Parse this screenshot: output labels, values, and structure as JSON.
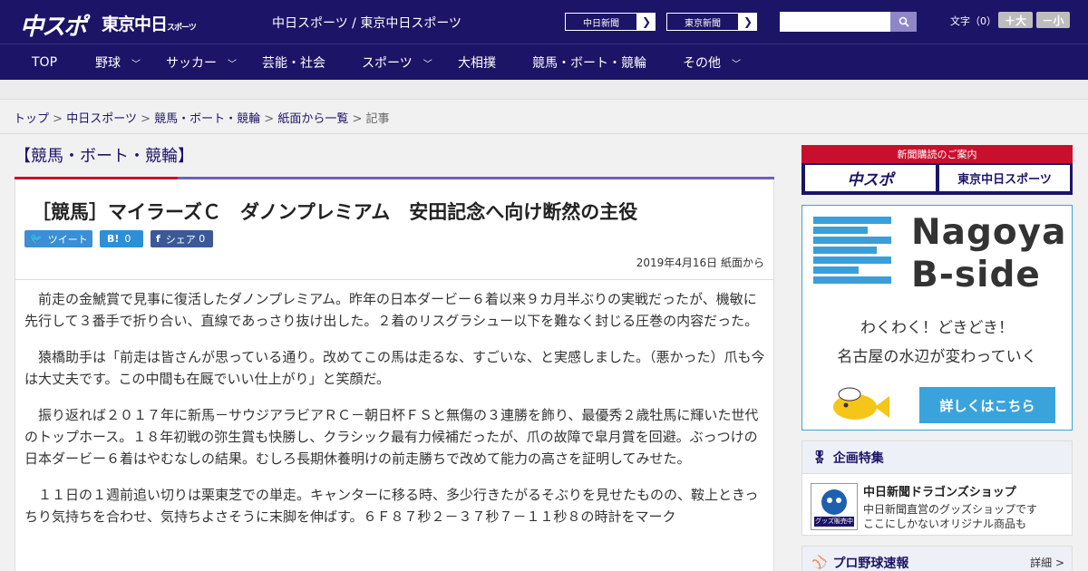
{
  "header": {
    "logo_chunichi_sports": "中スポ",
    "logo_tokyo": "東京中日",
    "logo_tokyo_small": "スポーツ",
    "site_names": "中日スポーツ / 東京中日スポーツ",
    "paper_links": [
      {
        "label": "中日新聞"
      },
      {
        "label": "東京新聞"
      }
    ],
    "search_placeholder": "",
    "font_size_label": "文字（0）",
    "font_bigger": "＋大",
    "font_smaller": "－小",
    "colors": {
      "brand_navy": "#1c1466",
      "brand_red": "#c8102e"
    }
  },
  "nav": {
    "items": [
      {
        "label": "TOP",
        "has_menu": false
      },
      {
        "label": "野球",
        "has_menu": true
      },
      {
        "label": "サッカー",
        "has_menu": true
      },
      {
        "label": "芸能・社会",
        "has_menu": false
      },
      {
        "label": "スポーツ",
        "has_menu": true
      },
      {
        "label": "大相撲",
        "has_menu": false
      },
      {
        "label": "競馬・ボート・競輪",
        "has_menu": false
      },
      {
        "label": "その他",
        "has_menu": true
      }
    ]
  },
  "breadcrumb": {
    "items": [
      "トップ",
      "中日スポーツ",
      "競馬・ボート・競輪",
      "紙面から一覧"
    ],
    "current": "記事",
    "separator": ">"
  },
  "article": {
    "category": "【競馬・ボート・競輪】",
    "headline": "［競馬］マイラーズＣ　ダノンプレミアム　安田記念へ向け断然の主役",
    "share": {
      "tweet": "ツイート",
      "hatena_icon": "B!",
      "hatena_count": "0",
      "facebook_label": "シェア",
      "facebook_count": "0"
    },
    "dateline": "2019年4月16日 紙面から",
    "paragraphs": [
      "前走の金鯱賞で見事に復活したダノンプレミアム。昨年の日本ダービー６着以来９カ月半ぶりの実戦だったが、機敏に先行して３番手で折り合い、直線であっさり抜け出した。２着のリスグラシュー以下を難なく封じる圧巻の内容だった。",
      "猿橋助手は「前走は皆さんが思っている通り。改めてこの馬は走るな、すごいな、と実感しました。（悪かった）爪も今は大丈夫です。この中間も在厩でいい仕上がり」と笑顔だ。",
      "振り返れば２０１７年に新馬－サウジアラビアＲＣ－朝日杯ＦＳと無傷の３連勝を飾り、最優秀２歳牡馬に輝いた世代のトップホース。１８年初戦の弥生賞も快勝し、クラシック最有力候補だったが、爪の故障で皐月賞を回避。ぶっつけの日本ダービー６着はやむなしの結果。むしろ長期休養明けの前走勝ちで改めて能力の高さを証明してみせた。",
      "１１日の１週前追い切りは栗東芝での単走。キャンターに移る時、多少行きたがるそぶりを見せたものの、鞍上ときっちり気持ちを合わせ、気持ちよさそうに末脚を伸ばす。６Ｆ８７秒２－３７秒７－１１秒８の時計をマーク"
    ]
  },
  "sidebar": {
    "subscribe_label": "新聞購読のご案内",
    "subscribe_buttons": [
      "中スポ",
      "東京中日スポーツ"
    ],
    "ad": {
      "title_line1": "Nagoya",
      "title_line2": "B-side",
      "sub1": "わくわく！どきどき！",
      "sub2": "名古屋の水辺が変わっていく",
      "cta": "詳しくはこちら"
    },
    "features": {
      "heading": "企画特集",
      "item_title": "中日新聞ドラゴンズショップ",
      "item_desc1": "中日新聞直営のグッズショップです",
      "item_desc2": "ここにしかないオリジナル商品も",
      "thumb_text": "グッズ販売中"
    },
    "baseball": {
      "heading": "プロ野球速報",
      "more": "詳細 >"
    }
  }
}
